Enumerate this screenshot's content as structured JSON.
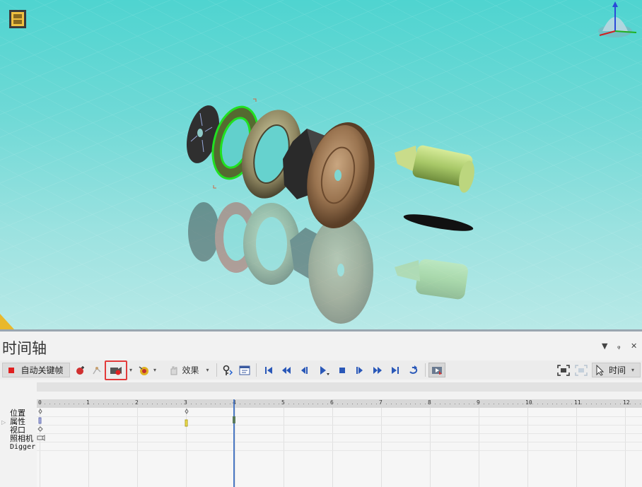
{
  "timeline": {
    "title": "时间轴",
    "controls": {
      "dropdown": "▼",
      "pin": "ᵩ",
      "close": "✕"
    },
    "toolbar": {
      "auto_keyframe_label": "自动关键帧",
      "effects_label": "效果",
      "time_label": "时间"
    },
    "ruler_ticks": [
      "0",
      "1",
      "2",
      "3",
      "4",
      "5",
      "6",
      "7",
      "8",
      "9",
      "10",
      "11",
      "12"
    ],
    "tracks": [
      "位置",
      "属性",
      "视口",
      "照相机",
      "Digger"
    ],
    "playhead_time": 4
  },
  "colors": {
    "accent_red": "#e23b3b",
    "playhead": "#4a78c4",
    "selection_green": "#21e021",
    "viewport_top": "#4fd4d0"
  },
  "icons": {
    "viewport": [
      "film-icon",
      "view-cube-icon",
      "corner-triangle-icon"
    ],
    "toolbar": [
      "record-icon",
      "add-keyframe-icon",
      "path-icon",
      "camera-keyframe-icon",
      "explode-icon",
      "effects-hand-icon",
      "key-filter-icon",
      "property-icon",
      "goto-start-icon",
      "prev-key-icon",
      "step-back-icon",
      "play-icon",
      "stop-icon",
      "step-forward-icon",
      "next-key-icon",
      "goto-end-icon",
      "loop-icon",
      "export-video-icon",
      "zoom-fit-icon",
      "zoom-select-icon",
      "pointer-icon"
    ]
  }
}
